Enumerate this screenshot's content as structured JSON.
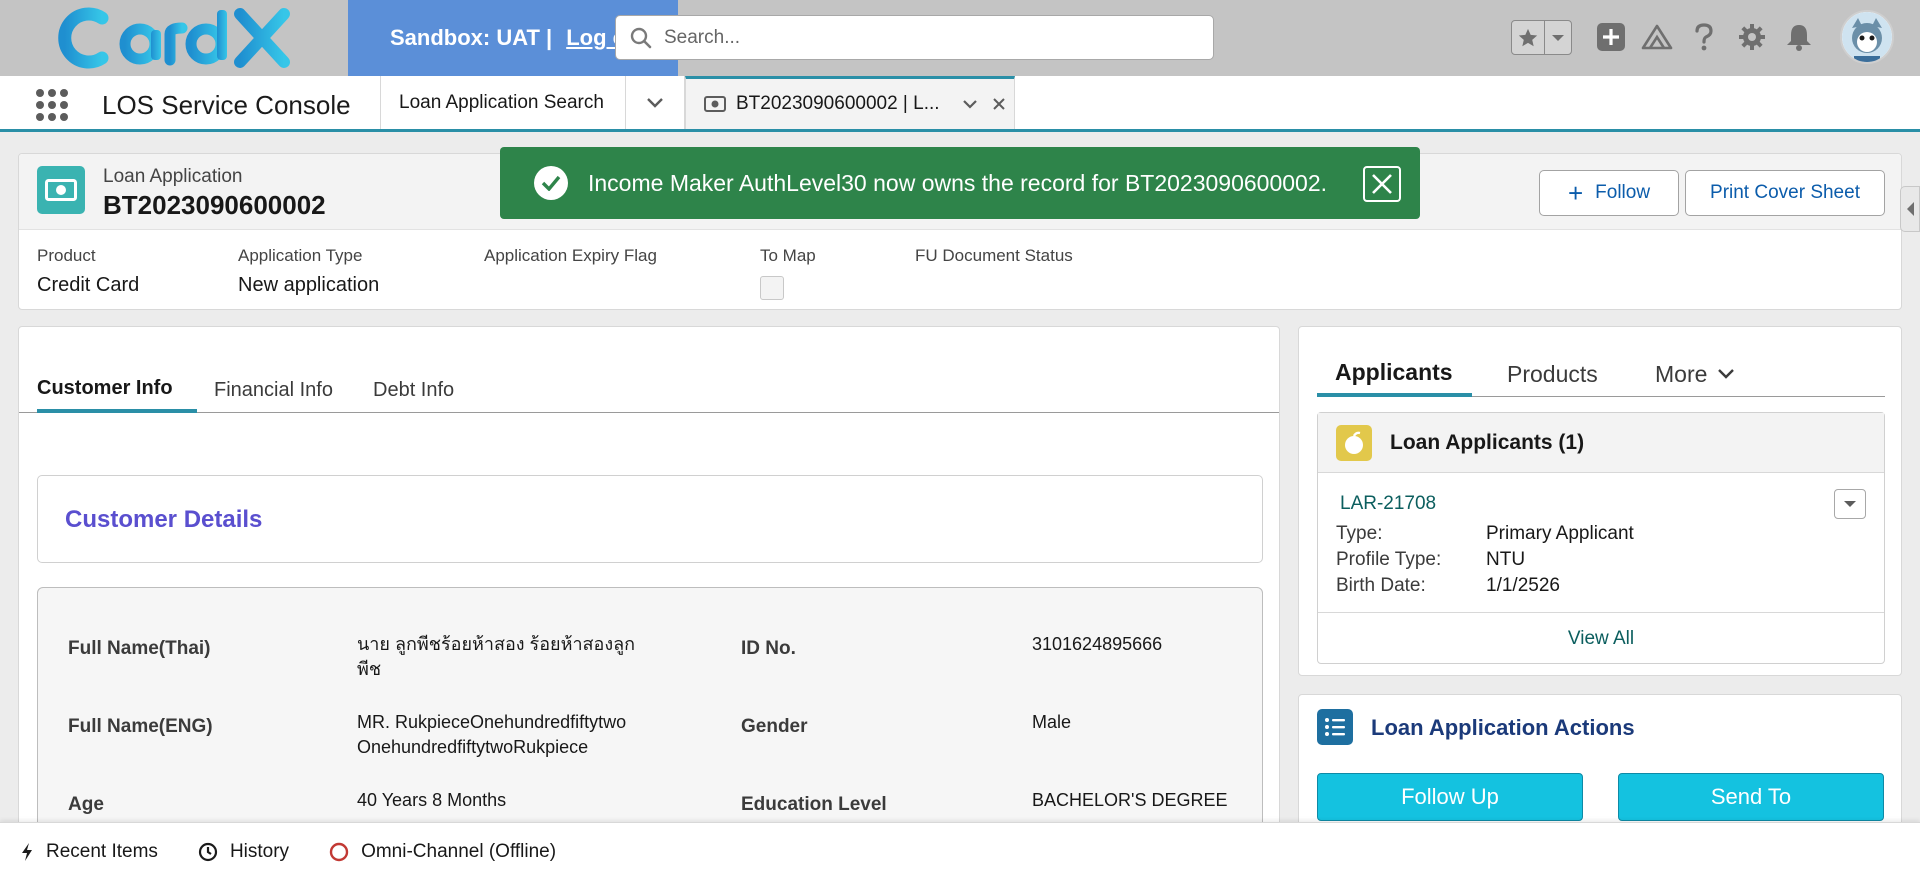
{
  "header": {
    "logo_text": "CardX",
    "sandbox_label": "Sandbox: UAT |",
    "logout_label": "Log out",
    "search_placeholder": "Search...",
    "icons": [
      "favorites-star-icon",
      "favorites-dropdown-icon",
      "global-add-icon",
      "trailhead-icon",
      "help-icon",
      "setup-gear-icon",
      "notifications-bell-icon",
      "user-avatar"
    ]
  },
  "nav": {
    "app_name": "LOS Service Console",
    "tabs": [
      {
        "label": "Loan Application Search"
      },
      {
        "label": "BT2023090600002 | L..."
      }
    ]
  },
  "record": {
    "object_type": "Loan Application",
    "name": "BT2023090600002",
    "follow_label": "Follow",
    "print_label": "Print Cover Sheet",
    "fields": [
      {
        "label": "Product",
        "value": "Credit Card"
      },
      {
        "label": "Application Type",
        "value": "New application"
      },
      {
        "label": "Application Expiry Flag",
        "value": ""
      },
      {
        "label": "To Map",
        "value": ""
      },
      {
        "label": "FU Document Status",
        "value": ""
      }
    ]
  },
  "toast": {
    "message": "Income Maker AuthLevel30 now owns the record for BT2023090600002.",
    "color": "#2e844a"
  },
  "main": {
    "tabs": [
      {
        "label": "Customer Info",
        "active": true
      },
      {
        "label": "Financial Info",
        "active": false
      },
      {
        "label": "Debt Info",
        "active": false
      }
    ],
    "section_title": "Customer Details",
    "details": [
      {
        "label": "Full Name(Thai)",
        "value": "นาย ลูกพีชร้อยห้าสอง ร้อยห้าสองลูกพีช"
      },
      {
        "label": "ID No.",
        "value": "3101624895666"
      },
      {
        "label": "Full Name(ENG)",
        "value": "MR. RukpieceOnehundredfiftytwo OnehundredfiftytwoRukpiece"
      },
      {
        "label": "Gender",
        "value": "Male"
      },
      {
        "label": "Age",
        "value": "40 Years 8 Months"
      },
      {
        "label": "Education Level",
        "value": "BACHELOR'S DEGREE"
      }
    ]
  },
  "right": {
    "tabs": [
      {
        "label": "Applicants",
        "active": true
      },
      {
        "label": "Products",
        "active": false
      },
      {
        "label": "More",
        "active": false
      }
    ],
    "applicants_card": {
      "title": "Loan Applicants (1)",
      "record_link": "LAR-21708",
      "rows": [
        {
          "key": "Type:",
          "value": "Primary Applicant"
        },
        {
          "key": "Profile Type:",
          "value": "NTU"
        },
        {
          "key": "Birth Date:",
          "value": "1/1/2526"
        }
      ],
      "view_all": "View All"
    },
    "actions_card": {
      "title": "Loan Application Actions",
      "follow_up": "Follow Up",
      "send_to": "Send To"
    }
  },
  "footer": {
    "items": [
      {
        "label": "Recent Items"
      },
      {
        "label": "History"
      },
      {
        "label": "Omni-Channel (Offline)"
      }
    ]
  },
  "colors": {
    "accent": "#2a8fa7",
    "action_button": "#14c2e0",
    "section_title": "#5a4fcf",
    "sandbox_bar": "#5b8fd8"
  }
}
